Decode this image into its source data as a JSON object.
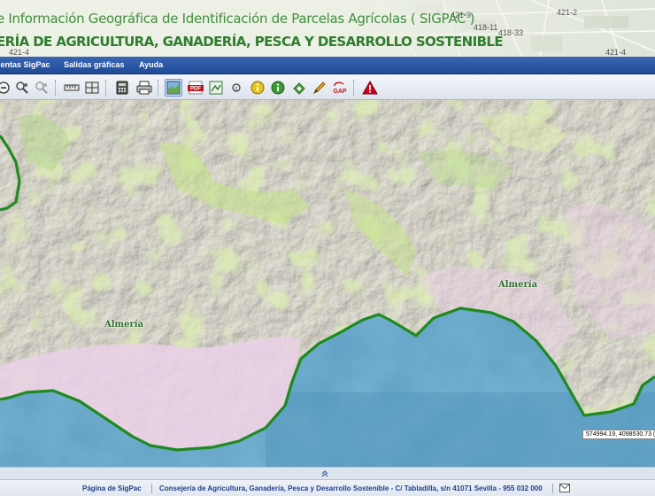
{
  "header": {
    "title": "e Información Geográfica de Identificación de Parcelas Agrícolas ( SIGPAC )",
    "subtitle": "ERÍA DE AGRICULTURA, GANADERÍA, PESCA Y DESARROLLO SOSTENIBLE",
    "parcel_labels": [
      "421-9",
      "421-2",
      "418-11",
      "418-33",
      "421-4",
      "421-4"
    ]
  },
  "menu": {
    "items": [
      "ientas SigPac",
      "Salidas gráficas",
      "Ayuda"
    ]
  },
  "toolbar": {
    "icons": [
      "zoom-out-icon",
      "search-user-icon",
      "search-user-disabled-icon",
      "measure-distance-icon",
      "measure-area-icon",
      "calculator-icon",
      "print-icon",
      "map-layers-icon",
      "pdf-export-icon",
      "image-export-icon",
      "coordinate-icon",
      "info-icon",
      "info-green-icon",
      "navigate-icon",
      "draw-icon",
      "gap-icon",
      "warning-icon"
    ],
    "pdf_label": "PDF",
    "gap_label": "GAP"
  },
  "map": {
    "place_labels": [
      "Almería",
      "Almería"
    ],
    "coordinates": "574994.19, 4098530.73 (E",
    "colors": {
      "sea": "#5fa0c4",
      "land": "#e6e3d6",
      "boundary": "#1f8a1f",
      "crops": "#ead0e8",
      "vegetation": "#bfe08a"
    }
  },
  "footer": {
    "link": "Página de SigPac",
    "text": "Consejería de Agricultura, Ganadería, Pesca y Desarrollo Sostenible - C/ Tabladilla, s/n 41071 Sevilla - 955 032 000"
  }
}
